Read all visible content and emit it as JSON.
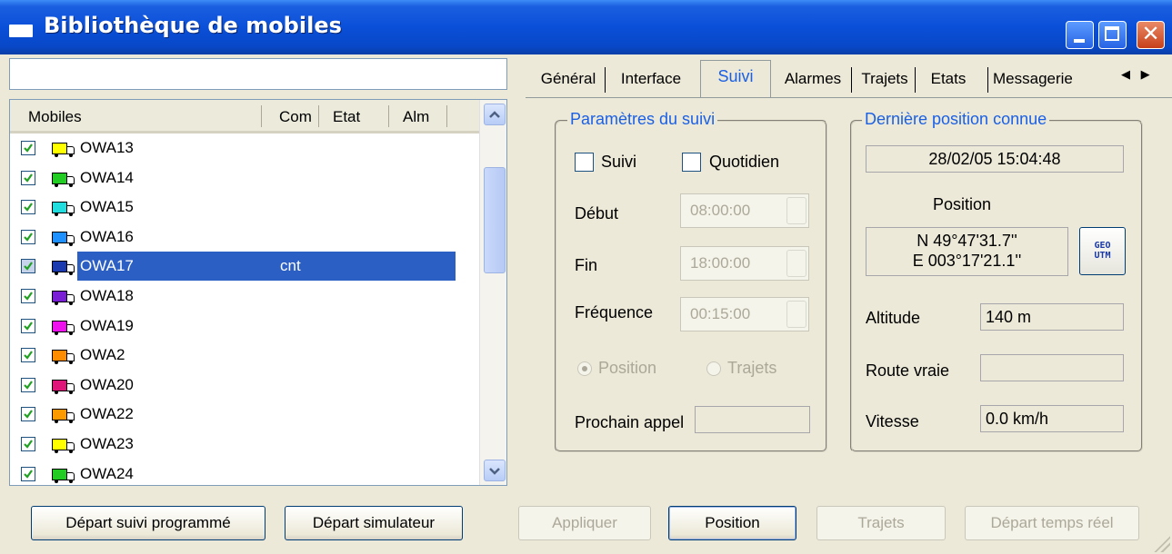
{
  "window": {
    "title": "Bibliothèque de mobiles"
  },
  "list": {
    "columns": [
      "Mobiles",
      "Com",
      "Etat",
      "Alm"
    ],
    "rows": [
      {
        "name": "OWA13",
        "com": "",
        "color": "#ffff00",
        "checked": true
      },
      {
        "name": "OWA14",
        "com": "",
        "color": "#22cc22",
        "checked": true
      },
      {
        "name": "OWA15",
        "com": "",
        "color": "#22dddd",
        "checked": true
      },
      {
        "name": "OWA16",
        "com": "",
        "color": "#1e90ff",
        "checked": true
      },
      {
        "name": "OWA17",
        "com": "cnt",
        "color": "#1c3ab0",
        "checked": true,
        "selected": true
      },
      {
        "name": "OWA18",
        "com": "",
        "color": "#7a1ed6",
        "checked": true
      },
      {
        "name": "OWA19",
        "com": "",
        "color": "#ee11ee",
        "checked": true
      },
      {
        "name": "OWA2",
        "com": "",
        "color": "#ff8c00",
        "checked": true
      },
      {
        "name": "OWA20",
        "com": "",
        "color": "#e0157a",
        "checked": true
      },
      {
        "name": "OWA22",
        "com": "",
        "color": "#ff9900",
        "checked": true
      },
      {
        "name": "OWA23",
        "com": "",
        "color": "#ffff00",
        "checked": true
      },
      {
        "name": "OWA24",
        "com": "",
        "color": "#22cc22",
        "checked": true
      }
    ]
  },
  "tabs": [
    "Général",
    "Interface",
    "Suivi",
    "Alarmes",
    "Trajets",
    "Etats",
    "Messagerie"
  ],
  "active_tab": "Suivi",
  "suivi": {
    "group_title": "Paramètres du suivi",
    "chk_suivi": "Suivi",
    "chk_quotidien": "Quotidien",
    "debut_label": "Début",
    "debut_value": "08:00:00",
    "fin_label": "Fin",
    "fin_value": "18:00:00",
    "freq_label": "Fréquence",
    "freq_value": "00:15:00",
    "radio_position": "Position",
    "radio_trajets": "Trajets",
    "prochain_label": "Prochain appel",
    "prochain_value": ""
  },
  "derniere": {
    "group_title": "Dernière position connue",
    "datetime": "28/02/05 15:04:48",
    "position_label": "Position",
    "lat": "N 49°47'31.7''",
    "lon": "E 003°17'21.1''",
    "geo_btn_line1": "GEO",
    "geo_btn_line2": "UTM",
    "altitude_label": "Altitude",
    "altitude_value": "140 m",
    "route_label": "Route vraie",
    "route_value": "",
    "vitesse_label": "Vitesse",
    "vitesse_value": "0.0 km/h"
  },
  "buttons": {
    "depart_suivi": "Départ suivi programmé",
    "depart_sim": "Départ simulateur",
    "appliquer": "Appliquer",
    "position": "Position",
    "trajets": "Trajets",
    "depart_temps_reel": "Départ temps réel"
  }
}
